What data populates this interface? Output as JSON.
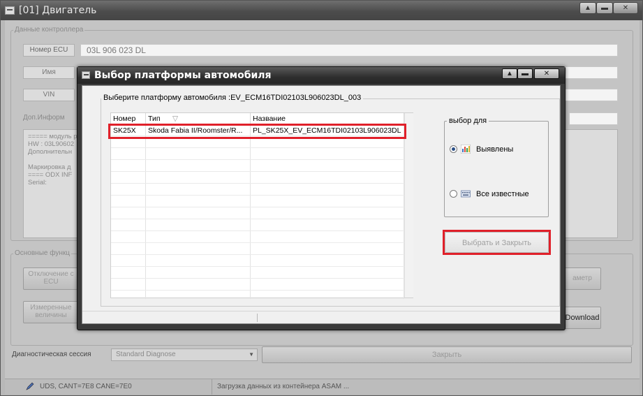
{
  "main_window": {
    "title": "[01] Двигатель",
    "buttons": {
      "minimize": "▲",
      "maximize": "▬",
      "close": "✕"
    },
    "controller_group": "Данные контроллера",
    "fields": [
      {
        "label": "Номер ECU",
        "value": "03L 906 023 DL"
      },
      {
        "label": "Имя",
        "value": ""
      },
      {
        "label": "VIN",
        "value": ""
      }
    ],
    "info_label": "Доп.Информ",
    "info_lines": [
      "===== модуль р",
      "HW : 03L90602",
      "Дополнительн",
      "",
      "Маркировка д",
      "==== ODX INF",
      "Serial:"
    ],
    "functions_group": "Основные функц",
    "func_buttons": [
      "Отключение с ECU",
      "Измеренные величины"
    ],
    "right_buttons": [
      "аметр",
      "Download"
    ],
    "session_label": "Диагностическая сессия",
    "session_value": "Standard Diagnose",
    "close_label": "Закрыть",
    "status_left": "UDS, CANT=7E8 CANE=7E0",
    "status_right": "Загрузка данных из контейнера ASAM ..."
  },
  "dialog": {
    "title": "Выбор платформы автомобиля",
    "buttons": {
      "minimize": "▲",
      "maximize": "▬",
      "close": "✕"
    },
    "group_label": "Выберите платформу автомобиля :EV_ECM16TDI02103L906023DL_003",
    "columns": [
      "Номер",
      "Тип",
      "Название"
    ],
    "sort_indicator": "▽",
    "rows": [
      {
        "number": "SK25X",
        "type": "Skoda Fabia II/Roomster/R...",
        "name": "PL_SK25X_EV_ECM16TDI02103L906023DL"
      }
    ],
    "choice_group": "выбор для",
    "options": [
      {
        "label": "Выявлены",
        "selected": true
      },
      {
        "label": "Все известные",
        "selected": false
      }
    ],
    "select_button": "Выбрать и Закрыть",
    "highlight_color": "#e0202a"
  }
}
